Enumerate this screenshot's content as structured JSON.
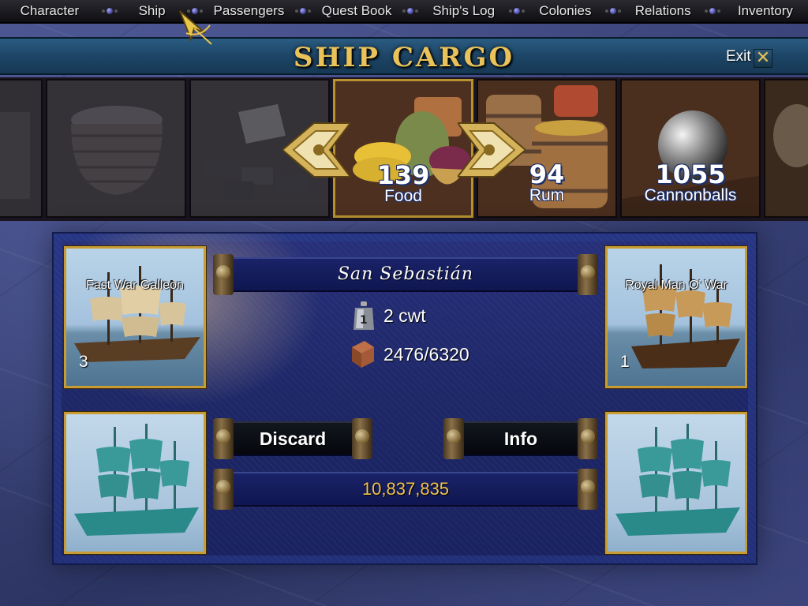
{
  "nav": {
    "items": [
      {
        "label": "Character"
      },
      {
        "label": "Ship"
      },
      {
        "label": "Passengers"
      },
      {
        "label": "Quest Book"
      },
      {
        "label": "Ship's Log"
      },
      {
        "label": "Colonies"
      },
      {
        "label": "Relations"
      },
      {
        "label": "Inventory"
      }
    ]
  },
  "header": {
    "title": "SHIP CARGO",
    "exit_label": "Exit",
    "close_glyph": "✕"
  },
  "cargo": {
    "items": [
      {
        "name": "",
        "count": "",
        "icon": "cargo-unknown-icon",
        "state": "dim"
      },
      {
        "name": "",
        "count": "",
        "icon": "basket-icon",
        "state": "dim"
      },
      {
        "name": "",
        "count": "",
        "icon": "bricks-icon",
        "state": "dim"
      },
      {
        "name": "Food",
        "count": "139",
        "icon": "food-icon",
        "state": "selected"
      },
      {
        "name": "Rum",
        "count": "94",
        "icon": "barrel-icon",
        "state": "normal"
      },
      {
        "name": "Cannonballs",
        "count": "1055",
        "icon": "cannonball-icon",
        "state": "normal"
      },
      {
        "name": "",
        "count": "",
        "icon": "cargo-partial-icon",
        "state": "normal"
      }
    ]
  },
  "ship": {
    "name": "San Sebastián",
    "weight": "2 cwt",
    "capacity": "2476/6320",
    "weight_icon": "weight-icon",
    "crate_icon": "crate-icon",
    "weight_glyph": "1"
  },
  "left_ship": {
    "type": "Fast War Galleon",
    "qty": "3"
  },
  "right_ship": {
    "type": "Royal Man O' War",
    "qty": "1"
  },
  "actions": {
    "discard": "Discard",
    "info": "Info"
  },
  "money": "10,837,835",
  "colors": {
    "gold": "#f0c24e",
    "frame": "#c89b33",
    "title": "#e9c25a",
    "panel": "#1e2767"
  }
}
